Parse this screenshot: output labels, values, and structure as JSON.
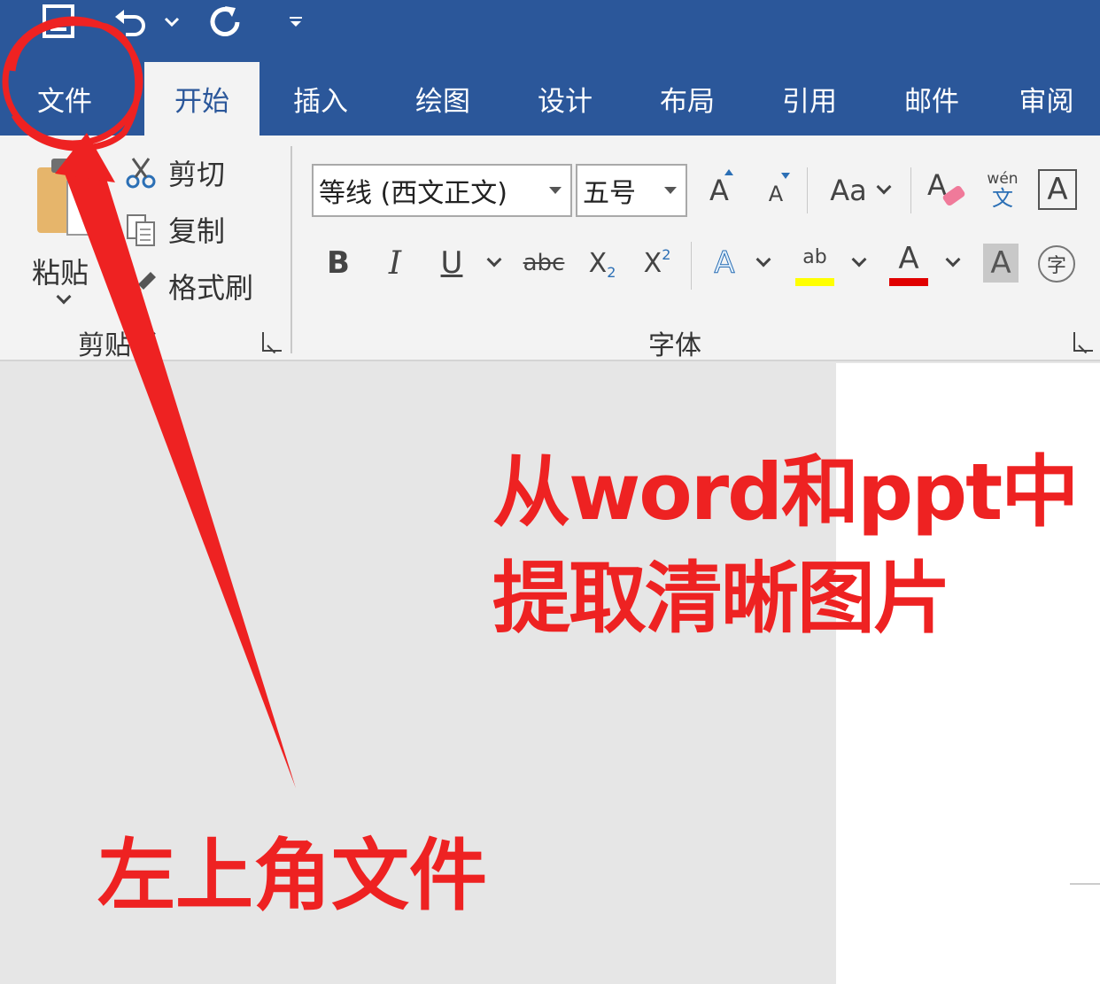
{
  "quick_access": {
    "save_icon": "save-icon",
    "undo_icon": "undo-icon",
    "undo_dropdown_icon": "chevron-down-icon",
    "redo_icon": "redo-icon",
    "customize_icon": "customize-quick-access-icon"
  },
  "tabs": [
    {
      "label": "文件"
    },
    {
      "label": "开始"
    },
    {
      "label": "插入"
    },
    {
      "label": "绘图"
    },
    {
      "label": "设计"
    },
    {
      "label": "布局"
    },
    {
      "label": "引用"
    },
    {
      "label": "邮件"
    },
    {
      "label": "审阅"
    }
  ],
  "active_tab": "开始",
  "clipboard": {
    "paste_label": "粘贴",
    "cut_label": "剪切",
    "copy_label": "复制",
    "format_painter_label": "格式刷",
    "group_label": "剪贴板"
  },
  "font": {
    "font_name": "等线 (西文正文)",
    "font_size": "五号",
    "grow_glyph": "A",
    "shrink_glyph": "A",
    "case_glyph": "Aa",
    "pinyin_top": "wén",
    "pinyin_bottom": "文",
    "border_glyph": "A",
    "bold_glyph": "B",
    "italic_glyph": "I",
    "underline_glyph": "U",
    "strike_glyph": "abc",
    "subscript_glyph": "X",
    "subscript_digit": "2",
    "superscript_glyph": "X",
    "superscript_digit": "2",
    "effects_glyph": "A",
    "highlight_glyph": "ab",
    "color_glyph": "A",
    "shading_glyph": "A",
    "enclose_glyph": "字",
    "group_label": "字体"
  },
  "colors": {
    "title_bar": "#2b579a",
    "ribbon": "#f3f3f3",
    "highlight_bar": "#ffff00",
    "font_color_bar": "#e00000",
    "annotation": "#ee2222"
  },
  "annotations": {
    "line1": "从word和ppt中",
    "line2": "提取清晰图片",
    "line3": "左上角文件"
  }
}
